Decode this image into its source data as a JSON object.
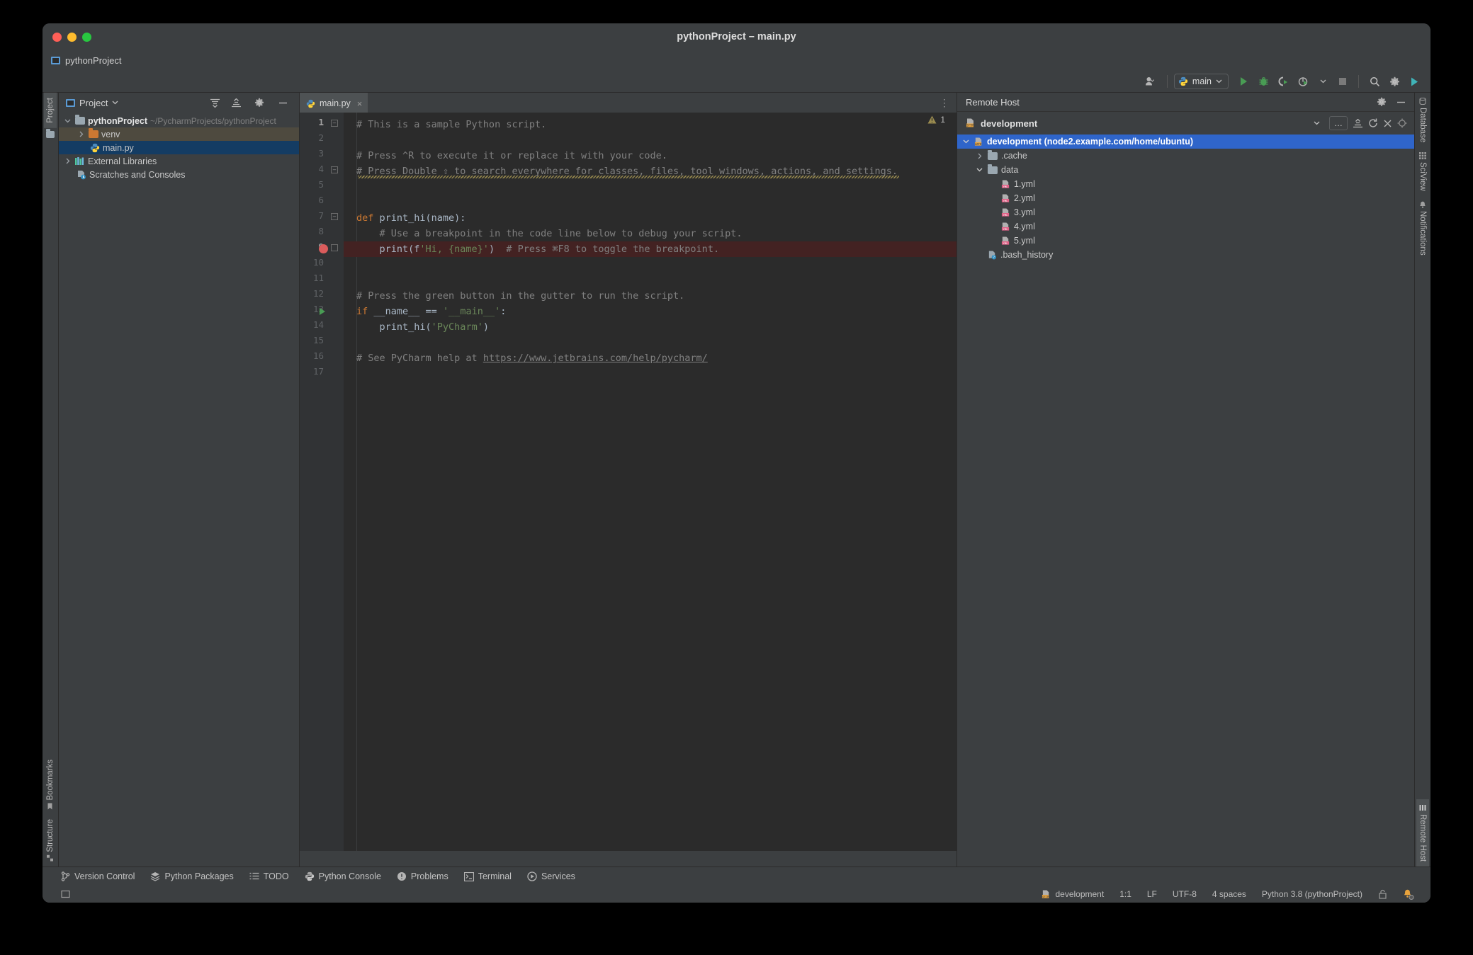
{
  "window": {
    "title": "pythonProject – main.py",
    "project_label": "pythonProject"
  },
  "toolbar": {
    "run_config": "main",
    "icons": [
      "user-icon",
      "run-icon",
      "debug-icon",
      "run-coverage-icon",
      "profile-icon",
      "stop-icon",
      "search-icon",
      "settings-icon",
      "updates-icon"
    ]
  },
  "project_panel": {
    "title": "Project",
    "tree": [
      {
        "label": "pythonProject",
        "path": "~/PycharmProjects/pythonProject",
        "icon": "folder-icon",
        "expanded": true
      },
      {
        "label": "venv",
        "icon": "folder-orange-icon",
        "expanded": false
      },
      {
        "label": "main.py",
        "icon": "python-file-icon",
        "selected": true
      },
      {
        "label": "External Libraries",
        "icon": "libraries-icon",
        "expanded": false
      },
      {
        "label": "Scratches and Consoles",
        "icon": "scratches-icon"
      }
    ]
  },
  "left_stripe": {
    "top": [
      {
        "label": "Project",
        "icon": "project-icon"
      }
    ],
    "bottom": [
      {
        "label": "Bookmarks",
        "icon": "bookmark-icon"
      },
      {
        "label": "Structure",
        "icon": "structure-icon"
      }
    ]
  },
  "right_stripe": {
    "top": [
      {
        "label": "Database",
        "icon": "database-icon"
      },
      {
        "label": "SciView",
        "icon": "sciview-icon"
      },
      {
        "label": "Notifications",
        "icon": "notifications-icon"
      }
    ],
    "bottom": [
      {
        "label": "Remote Host",
        "icon": "remote-host-icon"
      }
    ]
  },
  "editor": {
    "tab": {
      "label": "main.py",
      "icon": "python-file-icon",
      "close": "×"
    },
    "warning_count": "1",
    "line_count": 17,
    "lines": [
      {
        "n": 1,
        "text": "# This is a sample Python script.",
        "fold": true
      },
      {
        "n": 2,
        "text": ""
      },
      {
        "n": 3,
        "text": "# Press ^R to execute it or replace it with your code."
      },
      {
        "n": 4,
        "text": "# Press Double ⇧ to search everywhere for classes, files, tool windows, actions, and settings.",
        "fold": true,
        "wavy": true
      },
      {
        "n": 5,
        "text": ""
      },
      {
        "n": 6,
        "text": ""
      },
      {
        "n": 7,
        "text": "def print_hi(name):",
        "fold": true
      },
      {
        "n": 8,
        "text": "    # Use a breakpoint in the code line below to debug your script."
      },
      {
        "n": 9,
        "text": "    print(f'Hi, {name}')  # Press ⌘F8 to toggle the breakpoint.",
        "breakpoint": true,
        "highlight": true
      },
      {
        "n": 10,
        "text": ""
      },
      {
        "n": 11,
        "text": ""
      },
      {
        "n": 12,
        "text": "# Press the green button in the gutter to run the script."
      },
      {
        "n": 13,
        "text": "if __name__ == '__main__':",
        "run_arrow": true
      },
      {
        "n": 14,
        "text": "    print_hi('PyCharm')"
      },
      {
        "n": 15,
        "text": ""
      },
      {
        "n": 16,
        "text": "# See PyCharm help at https://www.jetbrains.com/help/pycharm/",
        "link": "https://www.jetbrains.com/help/pycharm/"
      },
      {
        "n": 17,
        "text": ""
      }
    ]
  },
  "remote_host": {
    "title": "Remote Host",
    "connection": "development",
    "tree": [
      {
        "label": "development (node2.example.com/home/ubuntu)",
        "icon": "sftp-icon",
        "depth": 0,
        "expanded": true,
        "selected": true
      },
      {
        "label": ".cache",
        "icon": "folder-icon",
        "depth": 1,
        "expanded": false
      },
      {
        "label": "data",
        "icon": "folder-icon",
        "depth": 1,
        "expanded": true
      },
      {
        "label": "1.yml",
        "icon": "yml-file-icon",
        "depth": 2
      },
      {
        "label": "2.yml",
        "icon": "yml-file-icon",
        "depth": 2
      },
      {
        "label": "3.yml",
        "icon": "yml-file-icon",
        "depth": 2
      },
      {
        "label": "4.yml",
        "icon": "yml-file-icon",
        "depth": 2
      },
      {
        "label": "5.yml",
        "icon": "yml-file-icon",
        "depth": 2
      },
      {
        "label": ".bash_history",
        "icon": "unknown-file-icon",
        "depth": 1
      }
    ],
    "toolbar_icons": [
      "chevron-down-icon",
      "ellipsis-icon",
      "collapse-all-icon",
      "refresh-icon",
      "close-icon",
      "locate-icon"
    ]
  },
  "bottom_bar": [
    {
      "label": "Version Control",
      "icon": "branch-icon"
    },
    {
      "label": "Python Packages",
      "icon": "packages-icon"
    },
    {
      "label": "TODO",
      "icon": "todo-icon"
    },
    {
      "label": "Python Console",
      "icon": "python-console-icon"
    },
    {
      "label": "Problems",
      "icon": "problems-icon"
    },
    {
      "label": "Terminal",
      "icon": "terminal-icon"
    },
    {
      "label": "Services",
      "icon": "services-icon"
    }
  ],
  "status_bar": {
    "deployment": "development",
    "caret": "1:1",
    "line_sep": "LF",
    "encoding": "UTF-8",
    "indent": "4 spaces",
    "interpreter": "Python 3.8 (pythonProject)",
    "icons": [
      "sftp-icon",
      "lock-icon",
      "notification-icon"
    ]
  },
  "colors": {
    "accent_blue": "#2f65ca",
    "panel_bg": "#3c3f41",
    "editor_bg": "#2b2b2b",
    "gutter_bg": "#313335",
    "breakpoint_red": "#db5c5c",
    "run_green": "#499c54"
  }
}
